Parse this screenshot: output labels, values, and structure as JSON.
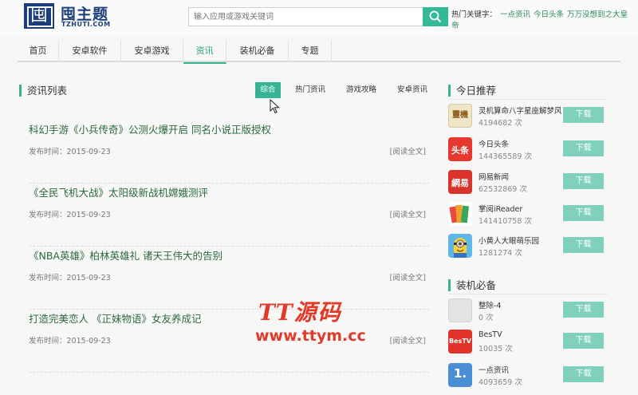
{
  "header": {
    "logo_title": "囤主题",
    "logo_sub": "TZHUTI.COM",
    "logo_mark": "囤",
    "search_placeholder": "输入应用或游戏关键词",
    "hot_label": "热门关键字：",
    "hot_keywords": [
      "一点资讯",
      "今日头条",
      "万万没想到之大皇帝"
    ]
  },
  "nav": {
    "items": [
      "首页",
      "安卓软件",
      "安卓游戏",
      "资讯",
      "装机必备",
      "专题"
    ],
    "active": "资讯"
  },
  "news": {
    "title": "资讯列表",
    "filters": [
      "综合",
      "热门资讯",
      "游戏攻略",
      "安卓资讯"
    ],
    "active_filter": "综合",
    "date_label": "发布时间：",
    "more_label": "[阅读全文]",
    "articles": [
      {
        "title": "科幻手游《小兵传奇》公测火爆开启 同名小说正版授权",
        "date": "2015-09-23"
      },
      {
        "title": "《全民飞机大战》太阳级新战机嫦娥测评",
        "date": "2015-09-23"
      },
      {
        "title": "《NBA英雄》柏林英雄礼 诸天王伟大的告别",
        "date": "2015-09-23"
      },
      {
        "title": "打造完美恋人 《正妹物语》女友养成记",
        "date": "2015-09-23"
      }
    ]
  },
  "watermark": {
    "line1": "TT源码",
    "line2": "www.ttym.cc"
  },
  "today": {
    "title": "今日推荐",
    "download_label": "下载",
    "count_suffix": "次",
    "apps": [
      {
        "name": "灵机算命八字星座解梦风水",
        "downloads": "4194682",
        "icon": "lingji-app-icon",
        "icon_text": "靈機",
        "color": "#d7c79a"
      },
      {
        "name": "今日头条",
        "downloads": "144365589",
        "icon": "toutiao-app-icon",
        "icon_text": "头条",
        "color": "#e6382f"
      },
      {
        "name": "网易新闻",
        "downloads": "62532869",
        "icon": "netease-news-app-icon",
        "icon_text": "網易",
        "color": "#d9342b"
      },
      {
        "name": "掌阅iReader",
        "downloads": "141410758",
        "icon": "ireader-app-icon",
        "icon_text": "",
        "color": "#e94a3f"
      },
      {
        "name": "小黄人大眼萌乐园",
        "downloads": "1281274",
        "icon": "minion-app-icon",
        "icon_text": "",
        "color": "#5fb6e8"
      }
    ]
  },
  "essentials": {
    "title": "装机必备",
    "apps": [
      {
        "name": "整除-4",
        "downloads": "0",
        "icon": "zhengchu-app-icon",
        "icon_text": "",
        "color": "#d9d9d9"
      },
      {
        "name": "BesTV",
        "downloads": "10035",
        "icon": "bestv-app-icon",
        "icon_text": "BesTV",
        "color": "#e0342a"
      },
      {
        "name": "一点资讯",
        "downloads": "4093659",
        "icon": "yidian-app-icon",
        "icon_text": "1.",
        "color": "#4a8fd6"
      }
    ]
  }
}
